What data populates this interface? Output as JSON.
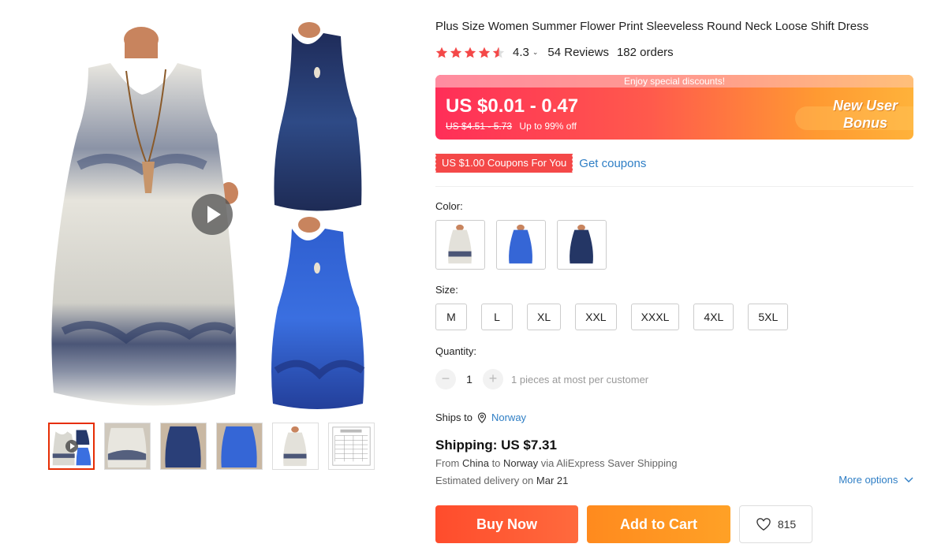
{
  "product": {
    "title": "Plus Size Women Summer Flower Print Sleeveless Round Neck Loose Shift Dress",
    "rating": "4.3",
    "rating_caret": "⌄",
    "reviews": "54 Reviews",
    "orders": "182 orders",
    "stars_filled": 4.3
  },
  "price": {
    "banner": "Enjoy special discounts!",
    "current": "US $0.01 - 0.47",
    "original": "US $4.51 - 5.73",
    "discount": "Up to 99% off",
    "promo_line1": "New User",
    "promo_line2": "Bonus"
  },
  "coupon": {
    "tag": "US $1.00 Coupons For You",
    "link": "Get coupons"
  },
  "color": {
    "label": "Color:",
    "options": [
      "white-blue print",
      "blue",
      "navy"
    ]
  },
  "size": {
    "label": "Size:",
    "options": [
      "M",
      "L",
      "XL",
      "XXL",
      "XXXL",
      "4XL",
      "5XL"
    ]
  },
  "quantity": {
    "label": "Quantity:",
    "minus": "−",
    "plus": "+",
    "value": "1",
    "note": "1 pieces at most per customer"
  },
  "shipping": {
    "ships_to_label": "Ships to",
    "country": "Norway",
    "title": "Shipping: US $7.31",
    "from_prefix": "From",
    "from": "China",
    "to_prefix": "to",
    "to": "Norway",
    "via": "via AliExpress Saver Shipping",
    "delivery_prefix": "Estimated delivery on",
    "delivery_date": "Mar 21",
    "more_options": "More options"
  },
  "actions": {
    "buy_now": "Buy Now",
    "add_to_cart": "Add to Cart",
    "wishlist_count": "815"
  },
  "colors": {
    "accent_red": "#e62e04",
    "link_blue": "#2e7ec5",
    "star": "#f44848"
  }
}
